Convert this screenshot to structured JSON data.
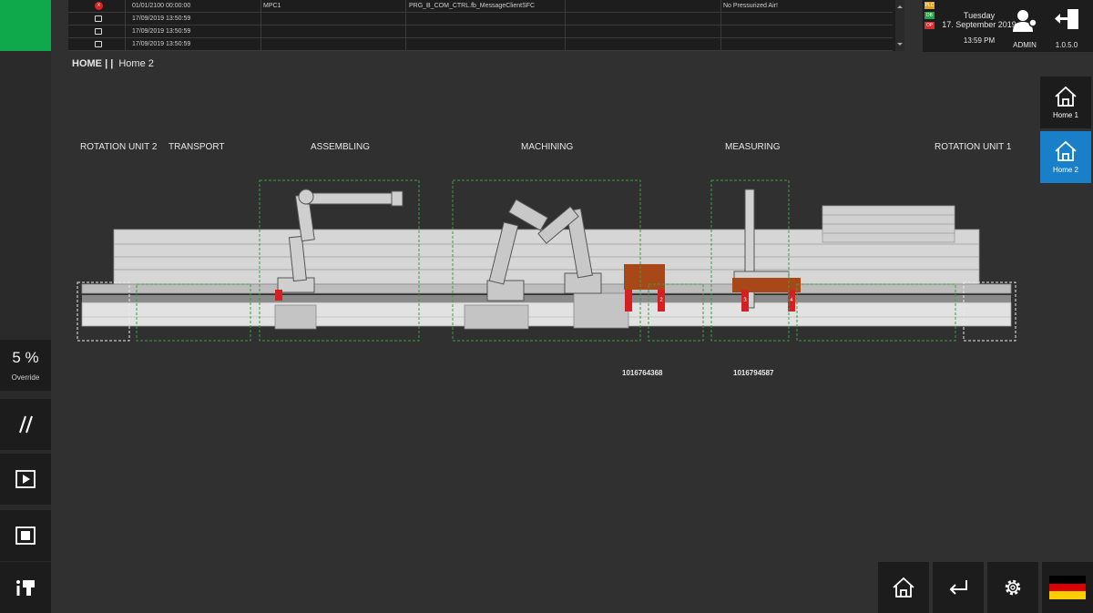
{
  "messages": {
    "rows": [
      {
        "icon": "error-icon",
        "icon_glyph": "x",
        "timestamp": "01/01/2100 00:00:00",
        "source": "MPC1",
        "module": "PRG_B_COM_CTRL.fb_MessageClientSFC",
        "text": "No Pressurized Air!"
      },
      {
        "icon": "book-icon",
        "icon_glyph": "",
        "timestamp": "17/09/2019 13:50:59",
        "source": "",
        "module": "",
        "text": ""
      },
      {
        "icon": "book-icon",
        "icon_glyph": "",
        "timestamp": "17/09/2019 13:50:59",
        "source": "",
        "module": "",
        "text": ""
      },
      {
        "icon": "book-icon",
        "icon_glyph": "",
        "timestamp": "17/09/2019 13:50:59",
        "source": "",
        "module": "",
        "text": ""
      }
    ]
  },
  "info": {
    "indicators": [
      {
        "label": "PLC",
        "color": "#e0a020"
      },
      {
        "label": "DB",
        "color": "#2aa04a"
      },
      {
        "label": "OP",
        "color": "#d03030"
      }
    ],
    "day": "Tuesday",
    "date": "17. September 2019",
    "time": "13:59 PM",
    "user": "ADMIN",
    "version": "1.0.5.0"
  },
  "breadcrumb": {
    "root": "HOME",
    "sep": "| |",
    "current": "Home 2"
  },
  "nav": [
    {
      "label": "Home 1",
      "active": false
    },
    {
      "label": "Home 2",
      "active": true
    }
  ],
  "stations": [
    "ROTATION UNIT 2",
    "TRANSPORT",
    "ASSEMBLING",
    "MACHINING",
    "MEASURING",
    "ROTATION UNIT 1"
  ],
  "workpiece_ids": [
    "1016764368",
    "1016794587"
  ],
  "carriers": [
    "1",
    "2",
    "3",
    "4"
  ],
  "override": {
    "value": "5 %",
    "label": "Override"
  },
  "colors": {
    "accent": "#1a7fc9",
    "status_ok": "#0fa84a",
    "carrier": "#d42020",
    "workpiece": "#a84818",
    "zone": "#3aa040"
  }
}
